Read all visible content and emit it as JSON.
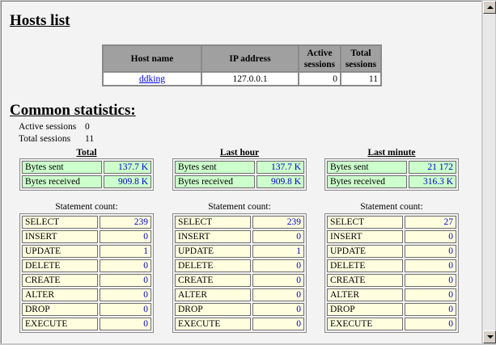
{
  "hosts": {
    "title": "Hosts list",
    "columns": [
      "Host name",
      "IP address",
      "Active sessions",
      "Total sessions"
    ],
    "rows": [
      {
        "host": "ddking",
        "ip": "127.0.0.1",
        "active": "0",
        "total": "11"
      }
    ]
  },
  "stats": {
    "title": "Common statistics:",
    "active_sessions_label": "Active sessions",
    "active_sessions_value": "0",
    "total_sessions_label": "Total sessions",
    "total_sessions_value": "11",
    "bytes_sent_label": "Bytes sent",
    "bytes_received_label": "Bytes received",
    "statement_count_label": "Statement count:",
    "blocks": [
      {
        "header": "Total",
        "bytes_sent": "137.7 K",
        "bytes_received": "909.8 K",
        "statements": [
          {
            "name": "SELECT",
            "count": "239"
          },
          {
            "name": "INSERT",
            "count": "0"
          },
          {
            "name": "UPDATE",
            "count": "1"
          },
          {
            "name": "DELETE",
            "count": "0"
          },
          {
            "name": "CREATE",
            "count": "0"
          },
          {
            "name": "ALTER",
            "count": "0"
          },
          {
            "name": "DROP",
            "count": "0"
          },
          {
            "name": "EXECUTE",
            "count": "0"
          }
        ]
      },
      {
        "header": "Last hour",
        "bytes_sent": "137.7 K",
        "bytes_received": "909.8 K",
        "statements": [
          {
            "name": "SELECT",
            "count": "239"
          },
          {
            "name": "INSERT",
            "count": "0"
          },
          {
            "name": "UPDATE",
            "count": "1"
          },
          {
            "name": "DELETE",
            "count": "0"
          },
          {
            "name": "CREATE",
            "count": "0"
          },
          {
            "name": "ALTER",
            "count": "0"
          },
          {
            "name": "DROP",
            "count": "0"
          },
          {
            "name": "EXECUTE",
            "count": "0"
          }
        ]
      },
      {
        "header": "Last minute",
        "bytes_sent": "21 172",
        "bytes_received": "316.3 K",
        "statements": [
          {
            "name": "SELECT",
            "count": "27"
          },
          {
            "name": "INSERT",
            "count": "0"
          },
          {
            "name": "UPDATE",
            "count": "0"
          },
          {
            "name": "DELETE",
            "count": "0"
          },
          {
            "name": "CREATE",
            "count": "0"
          },
          {
            "name": "ALTER",
            "count": "0"
          },
          {
            "name": "DROP",
            "count": "0"
          },
          {
            "name": "EXECUTE",
            "count": "0"
          }
        ]
      }
    ]
  },
  "colors": {
    "page_bg": "#f3f3f3",
    "header_bg": "#a0a0a0",
    "bytes_bg": "#ccffcc",
    "statement_bg": "#ffffe0",
    "value_text": "#0000cc",
    "link": "#0000ee"
  },
  "icons": {
    "scroll_up": "arrow-up-icon",
    "scroll_down": "arrow-down-icon",
    "resize": "resize-grip-icon"
  }
}
